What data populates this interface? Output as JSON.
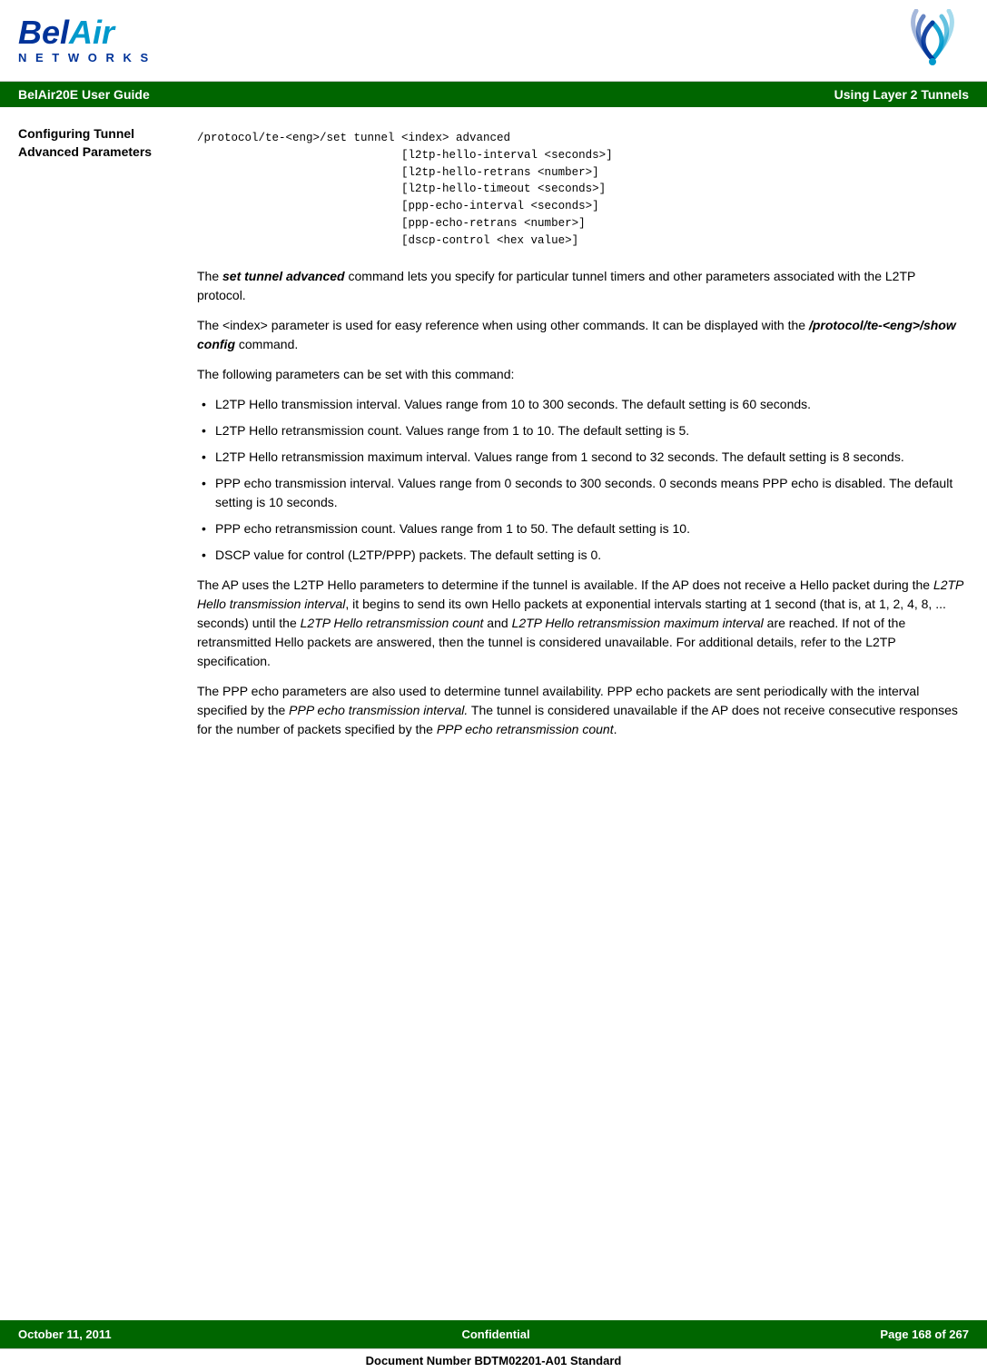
{
  "header": {
    "logo_bel": "Bel",
    "logo_air": "Air",
    "logo_networks": "N E T W O R K S",
    "title_left": "BelAir20E User Guide",
    "title_right": "Using Layer 2 Tunnels"
  },
  "sidebar": {
    "section_line1": "Configuring Tunnel",
    "section_line2": "Advanced Parameters"
  },
  "code": {
    "line1": "/protocol/te-<eng>/set tunnel <index> advanced",
    "line2": "                              [l2tp-hello-interval <seconds>]",
    "line3": "                              [l2tp-hello-retrans <number>]",
    "line4": "                              [l2tp-hello-timeout <seconds>]",
    "line5": "                              [ppp-echo-interval <seconds>]",
    "line6": "                              [ppp-echo-retrans <number>]",
    "line7": "                              [dscp-control <hex value>]"
  },
  "paragraphs": {
    "p1_pre": "The ",
    "p1_italic": "set tunnel advanced",
    "p1_post": " command lets you specify for particular tunnel timers and other parameters associated with the L2TP protocol.",
    "p2_pre": "The <index> parameter is used for easy reference when using other commands. It can be displayed with the ",
    "p2_italic": "/protocol/te-<eng>/show config",
    "p2_post": " command.",
    "p3": "The following parameters can be set with this command:",
    "bullet1": "L2TP Hello transmission interval. Values range from 10 to 300 seconds. The default setting is 60 seconds.",
    "bullet2": "L2TP Hello retransmission count. Values range from 1 to 10. The default setting is 5.",
    "bullet3": "L2TP Hello retransmission maximum interval. Values range from 1 second to 32 seconds. The default setting is 8 seconds.",
    "bullet4": "PPP echo transmission interval. Values range from 0 seconds to 300 seconds. 0 seconds means PPP echo is disabled. The default setting is 10 seconds.",
    "bullet5": "PPP echo retransmission count. Values range from 1 to 50. The default setting is 10.",
    "bullet6": "DSCP value for control (L2TP/PPP) packets. The default setting is 0.",
    "p4_pre": "The AP uses the L2TP Hello parameters to determine if the tunnel is available. If the AP does not receive a Hello packet during the ",
    "p4_italic1": "L2TP Hello transmission interval",
    "p4_mid1": ", it begins to send its own Hello packets at exponential intervals starting at 1 second (that is, at 1, 2, 4, 8, ... seconds) until the ",
    "p4_italic2": "L2TP Hello retransmission count",
    "p4_mid2": " and ",
    "p4_italic3": "L2TP Hello retransmission maximum interval",
    "p4_post": " are reached. If not of the retransmitted Hello packets are answered, then the tunnel is considered unavailable. For additional details, refer to the L2TP specification.",
    "p5_pre": "The PPP echo parameters are also used to determine tunnel availability. PPP echo packets are sent periodically with the interval specified by the ",
    "p5_italic1": "PPP echo transmission interval.",
    "p5_mid": " The tunnel is considered unavailable if the AP does not receive consecutive responses for the number of packets specified by the ",
    "p5_italic2": "PPP echo retransmission count",
    "p5_post": "."
  },
  "footer": {
    "date": "October 11, 2011",
    "confidential": "Confidential",
    "page": "Page 168 of 267",
    "doc_number": "Document Number BDTM02201-A01 Standard"
  }
}
